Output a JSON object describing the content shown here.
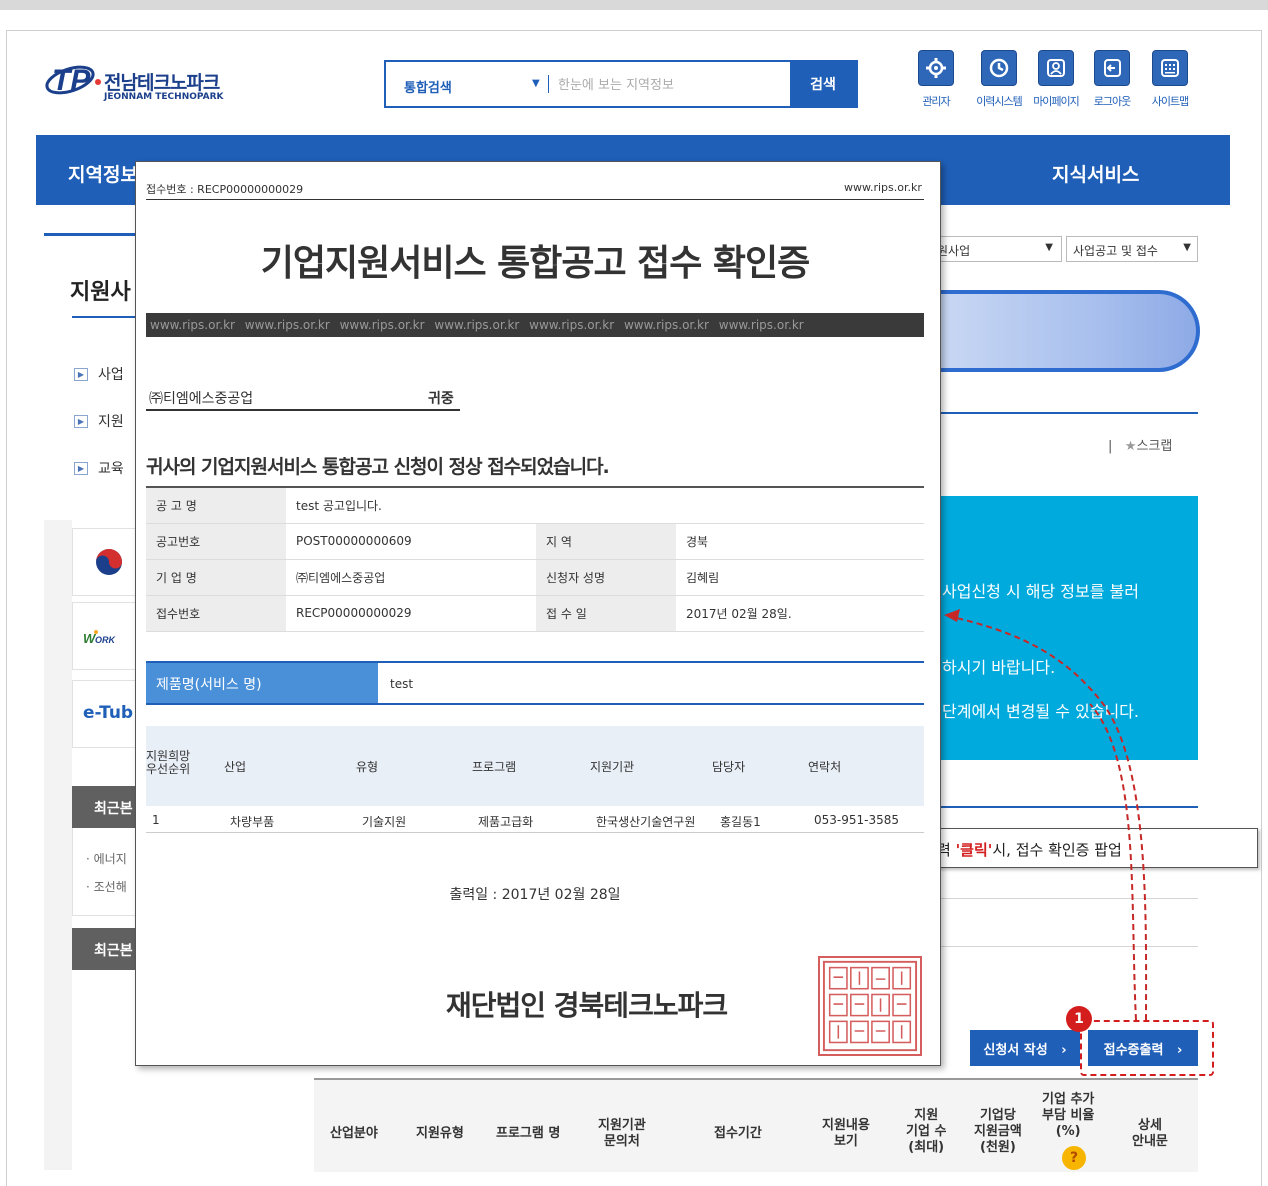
{
  "header": {
    "logo_ko": "전남테크노파크",
    "logo_en": "JEONNAM TECHNOPARK",
    "search_scope": "통합검색",
    "search_placeholder": "한눈에 보는 지역정보",
    "search_button": "검색",
    "tools": [
      {
        "label": "관리자",
        "icon": "gear-icon"
      },
      {
        "label": "이력시스템",
        "icon": "clock-icon"
      },
      {
        "label": "마이페이지",
        "icon": "user-icon"
      },
      {
        "label": "로그아웃",
        "icon": "logout-icon"
      },
      {
        "label": "사이트맵",
        "icon": "sitemap-icon"
      }
    ]
  },
  "nav": {
    "left_item": "지역정보",
    "right_item": "지식서비스"
  },
  "sidebar": {
    "title": "지원사",
    "items": [
      "사업",
      "지원",
      "교육"
    ],
    "recent1_title": "최근본",
    "recent_items": [
      "에너지",
      "조선해"
    ],
    "recent2_title": "최근본",
    "banners": [
      "e-Tub"
    ]
  },
  "content": {
    "select1": "원사업",
    "select2": "사업공고 및 접수",
    "scrap": "스크랩",
    "info_lines": [
      "사업신청 시 해당 정보를 불러",
      "하시기 바랍니다.",
      "단계에서 변경될 수 있습니다."
    ],
    "callout_prefix": "력 ",
    "callout_emphasis": "'클릭'",
    "callout_suffix": "시, 접수 확인증 팝업",
    "apply_button": "신청서 작성",
    "receipt_button": "접수증출력",
    "step_number": "1",
    "table_headers": [
      "산업분야",
      "지원유형",
      "프로그램 명",
      "지원기관\n문의처",
      "접수기간",
      "지원내용\n보기",
      "지원\n기업 수\n(최대)",
      "기업당\n지원금액\n(천원)",
      "기업 추가\n부담 비율\n(%)",
      "상세\n안내문"
    ],
    "help_glyph": "?"
  },
  "popup": {
    "receipt_number_label": "접수번호 : RECP00000000029",
    "site": "www.rips.or.kr",
    "title": "기업지원서비스 통합공고 접수 확인증",
    "band_text": "www.rips.or.kr  www.rips.or.kr  www.rips.or.kr  www.rips.or.kr  www.rips.or.kr  www.rips.or.kr  www.rips.or.kr",
    "company": "㈜티엠에스중공업",
    "honorific": "귀중",
    "message": "귀사의 기업지원서비스 통합공고 신청이 정상 접수되었습니다.",
    "rows": {
      "notice_label": "공 고 명",
      "notice_value": "test 공고입니다.",
      "notice_no_label": "공고번호",
      "notice_no_value": "POST00000000609",
      "region_label": "지 역",
      "region_value": "경북",
      "company_label": "기 업 명",
      "company_value": "㈜티엠에스중공업",
      "applicant_label": "신청자 성명",
      "applicant_value": "김혜림",
      "receipt_label": "접수번호",
      "receipt_value": "RECP00000000029",
      "date_label": "접 수 일",
      "date_value": "2017년 02월 28일."
    },
    "product_label": "제품명(서비스 명)",
    "product_value": "test",
    "support_headers": [
      "지원희망\n우선순위",
      "산업",
      "유형",
      "프로그램",
      "지원기관",
      "담당자",
      "연락처"
    ],
    "support_row": [
      "1",
      "차량부품",
      "기술지원",
      "제품고급화",
      "한국생산기술연구원",
      "홍길동1",
      "053-951-3585"
    ],
    "print_date": "출력일 : 2017년 02월 28일",
    "org": "재단법인 경북테크노파크",
    "seal_glyphs": "재단법인경북테크노파크이사장인"
  }
}
